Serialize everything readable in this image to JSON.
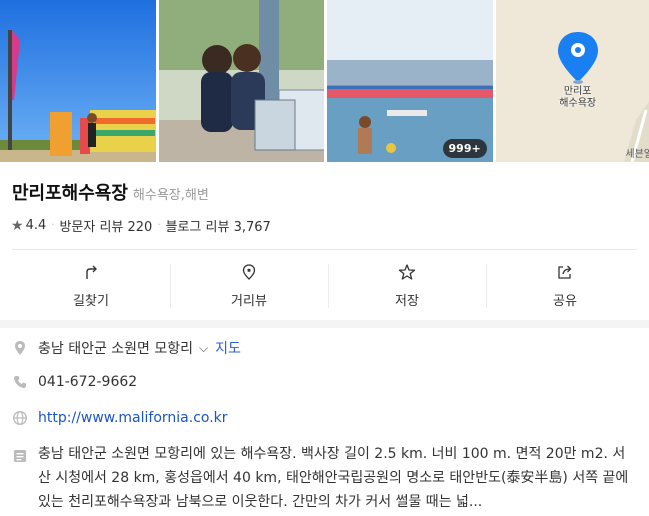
{
  "photos": {
    "count_badge": "999+",
    "map_label": "만리포\n해수욕장",
    "map_corner_text": "세븐일"
  },
  "place": {
    "name": "만리포해수욕장",
    "category": "해수욕장,해변",
    "rating": "4.4",
    "visitor_reviews": "방문자 리뷰 220",
    "blog_reviews": "블로그 리뷰 3,767"
  },
  "actions": {
    "directions": "길찾기",
    "street_view": "거리뷰",
    "save": "저장",
    "share": "공유"
  },
  "info": {
    "address": "충남 태안군 소원면 모항리",
    "map_link": "지도",
    "phone": "041-672-9662",
    "website": "http://www.malifornia.co.kr",
    "description": "충남 태안군 소원면 모항리에 있는 해수욕장. 백사장 길이 2.5 km. 너비 100 m. 면적 20만 m2. 서산 시청에서 28 km, 홍성읍에서 40 km, 태안해안국립공원의 명소로 태안반도(泰安半島) 서쪽 끝에 있는 천리포해수욕장과 남북으로 이웃한다. 간만의 차가 커서 썰물 때는 넓..."
  },
  "colors": {
    "link": "#1a55c7",
    "map_pin": "#1a7ff0"
  }
}
